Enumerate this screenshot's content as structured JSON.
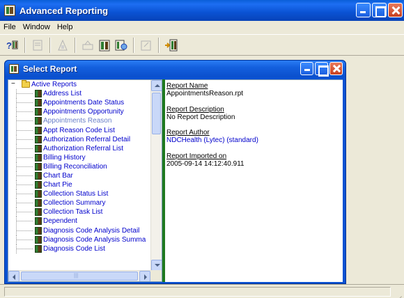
{
  "app": {
    "title": "Advanced Reporting"
  },
  "menu": {
    "items": [
      "File",
      "Window",
      "Help"
    ]
  },
  "toolbar": {
    "buttons": [
      "help-icon",
      "disabled-doc-icon",
      "disabled-report-icon",
      "disabled-print-icon",
      "report-book-icon",
      "report-search-icon",
      "disabled-export-icon",
      "exit-door-icon"
    ]
  },
  "child_window": {
    "title": "Select Report"
  },
  "tree": {
    "root_label": "Active Reports",
    "items": [
      "Address List",
      "Appointments Date Status",
      "Appointments Opportunity",
      "Appointments Reason",
      "Appt Reason Code List",
      "Authorization Referral Detail",
      "Authorization Referral List",
      "Billing History",
      "Billing Reconciliation",
      "Chart Bar",
      "Chart Pie",
      "Collection Status List",
      "Collection Summary",
      "Collection Task List",
      "Dependent",
      "Diagnosis Code Analysis Detail",
      "Diagnosis Code Analysis Summa",
      "Diagnosis Code List"
    ],
    "selected_item": "Appointments Reason"
  },
  "details": {
    "report_name_label": "Report Name",
    "report_name_value": "AppointmentsReason.rpt",
    "report_description_label": "Report Description",
    "report_description_value": "No Report Description",
    "report_author_label": "Report Author",
    "report_author_value": "NDCHealth (Lytec) (standard)",
    "report_imported_label": "Report Imported on",
    "report_imported_value": "2005-09-14 14:12:40.911"
  },
  "colors": {
    "titlebar": "#0a52d3",
    "splitter": "#1f7a1f",
    "tree_link": "#0000cc",
    "selected_item": "#6a7fc8"
  }
}
